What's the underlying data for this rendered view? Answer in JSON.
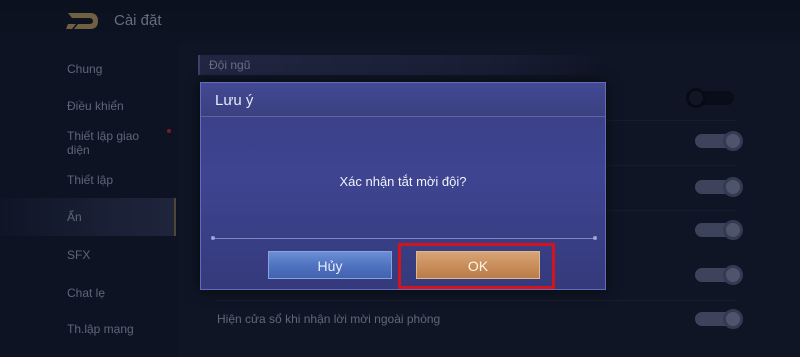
{
  "header": {
    "title": "Cài đặt",
    "back_icon": "back-logo-icon"
  },
  "sidebar": {
    "items": [
      {
        "label": "Chung"
      },
      {
        "label": "Điều khiển"
      },
      {
        "label": "Thiết lập giao diện",
        "has_badge": true
      },
      {
        "label": "Thiết lập"
      },
      {
        "label": "Ẩn",
        "active": true
      },
      {
        "label": "SFX"
      },
      {
        "label": "Chat lẹ"
      },
      {
        "label": "Th.lập mạng"
      }
    ]
  },
  "main": {
    "section_title": "Đội ngũ",
    "rows": [
      {
        "toggle": "off"
      },
      {
        "toggle": "on"
      },
      {
        "toggle": "on"
      },
      {
        "toggle": "on"
      },
      {
        "toggle": "on"
      },
      {
        "toggle": "on"
      },
      {
        "label": "Hiện cửa sổ khi nhận lời mời ngoài phòng",
        "toggle": "on"
      }
    ]
  },
  "dialog": {
    "title": "Lưu ý",
    "message": "Xác nhận tắt mời đội?",
    "cancel_label": "Hủy",
    "ok_label": "OK"
  },
  "colors": {
    "highlight": "#d3141c",
    "ok_button": "#c98d5a",
    "cancel_button": "#4f71bf",
    "dialog_bg": "#3a3f86"
  }
}
